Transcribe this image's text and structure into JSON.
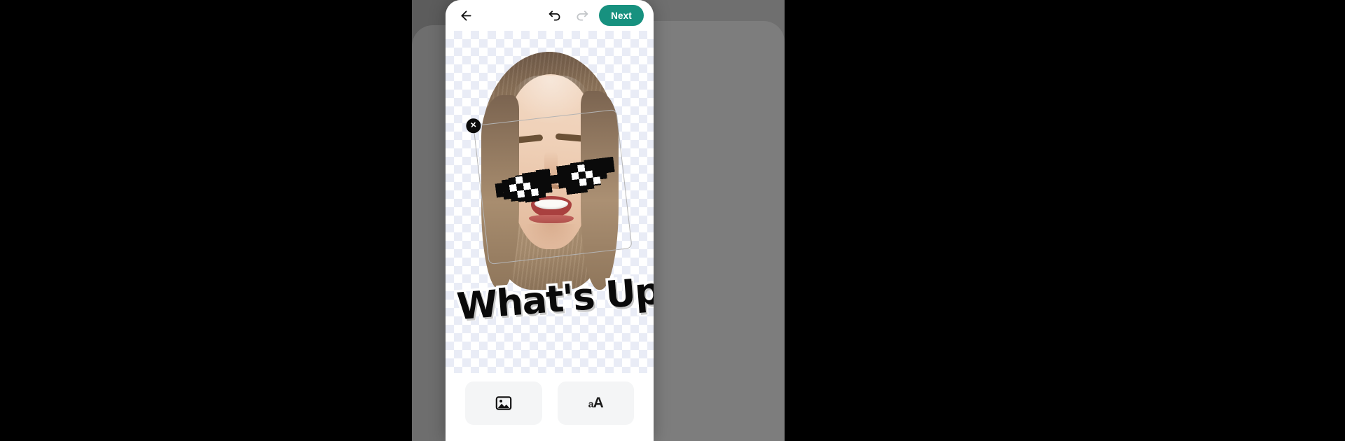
{
  "app": {
    "screen_name": "Sticker Editor",
    "accent_color": "#17917f",
    "canvas_background": "transparent-checkerboard"
  },
  "toolbar": {
    "back_icon": "arrow-left-icon",
    "back_label": "Back",
    "undo_icon": "undo-icon",
    "undo_label": "Undo",
    "undo_enabled": "true",
    "redo_icon": "redo-icon",
    "redo_label": "Redo",
    "redo_enabled": "false",
    "next_label": "Next"
  },
  "canvas": {
    "subject": "cut-out portrait of a smiling woman with long light-brown hair",
    "selection": {
      "visible": "true",
      "delete_icon": "close-x-icon",
      "delete_label": "✕",
      "rotation_deg": -6.5
    },
    "sticker": {
      "name": "deal-with-it-pixel-sunglasses",
      "type": "image-sticker",
      "rotation_deg": -7
    },
    "caption": {
      "text": "What's Up?",
      "fill_color": "#0a0a0a",
      "stroke_color": "#ffffff",
      "rotation_deg": -4.5
    }
  },
  "bottom_tools": [
    {
      "id": "add-image",
      "icon": "image-icon",
      "label": "Image"
    },
    {
      "id": "add-text",
      "icon": "text-size-icon",
      "label": "aA",
      "label_small": "a",
      "label_large": "A"
    }
  ]
}
